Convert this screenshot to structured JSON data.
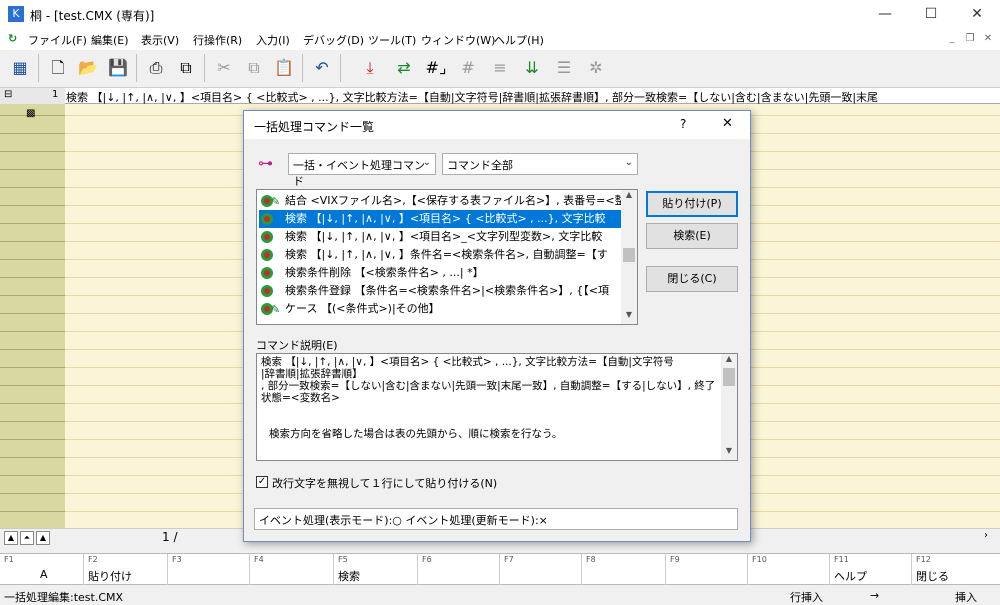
{
  "window": {
    "title": "桐 - [test.CMX (専有)]",
    "minimize": "—",
    "maximize": "☐",
    "close": "✕"
  },
  "menu": [
    "ファイル(F)",
    "編集(E)",
    "表示(V)",
    "行操作(R)",
    "入力(I)",
    "デバッグ(D)",
    "ツール(T)",
    "ウィンドウ(W)",
    "ヘルプ(H)"
  ],
  "formula_bar": {
    "row_number": "1",
    "text": "検索 【|↓, |↑, |∧, |∨, 】<項目名> { <比較式> , ...}, 文字比較方法=【自動|文字符号|辞書順|拡張辞書順】, 部分一致検索=【しない|含む|含まない|先頭一致|末尾"
  },
  "navigation": {
    "page": "1 /"
  },
  "dialog": {
    "title": "一括処理コマンド一覧",
    "help": "?",
    "close": "✕",
    "category_combo": "一括・イベント処理コマンド",
    "filter_combo": "コマンド全部",
    "commands": [
      {
        "text": "結合 <VIXファイル名>,【<保存する表ファイル名>】, 表番号=<整数",
        "pen": true,
        "selected": false
      },
      {
        "text": "検索 【|↓, |↑, |∧, |∨, 】<項目名> { <比較式> , ...}, 文字比較",
        "pen": false,
        "selected": true
      },
      {
        "text": "検索 【|↓, |↑, |∧, |∨, 】<項目名>_<文字列型変数>, 文字比較",
        "pen": false,
        "selected": false
      },
      {
        "text": "検索 【|↓, |↑, |∧, |∨, 】条件名=<検索条件名>, 自動調整=【す",
        "pen": false,
        "selected": false
      },
      {
        "text": "検索条件削除 【<検索条件名> , ...| *】",
        "pen": false,
        "selected": false
      },
      {
        "text": "検索条件登録 【条件名=<検索条件名>|<検索条件名>】, {【<項",
        "pen": false,
        "selected": false
      },
      {
        "text": "ケース 【(<条件式>)|その他】",
        "pen": true,
        "selected": false
      }
    ],
    "buttons": {
      "paste": "貼り付け(P)",
      "search": "検索(E)",
      "close": "閉じる(C)"
    },
    "description_label": "コマンド説明(E)",
    "description_lines": [
      "検索 【|↓, |↑, |∧, |∨, 】<項目名> { <比較式> , ...}, 文字比較方法=【自動|文字符号",
      "|辞書順|拡張辞書順】",
      ", 部分一致検索=【しない|含む|含まない|先頭一致|末尾一致】, 自動調整=【する|しない】, 終了",
      "状態=<変数名>",
      "",
      "",
      "検索方向を省略した場合は表の先頭から、順に検索を行なう。"
    ],
    "checkbox_label": "改行文字を無視して１行にして貼り付ける(N)",
    "checkbox_checked": true,
    "event_status": "イベント処理(表示モード):○ イベント処理(更新モード):×"
  },
  "function_keys": [
    {
      "num": "F1",
      "label": "A"
    },
    {
      "num": "F2",
      "label": "貼り付け"
    },
    {
      "num": "F3",
      "label": ""
    },
    {
      "num": "F4",
      "label": ""
    },
    {
      "num": "F5",
      "label": "検索"
    },
    {
      "num": "F6",
      "label": ""
    },
    {
      "num": "F7",
      "label": ""
    },
    {
      "num": "F8",
      "label": ""
    },
    {
      "num": "F9",
      "label": ""
    },
    {
      "num": "F10",
      "label": ""
    },
    {
      "num": "F11",
      "label": "ヘルプ"
    },
    {
      "num": "F12",
      "label": "閉じる"
    }
  ],
  "status_bar": {
    "mode": "一括処理編集:test.CMX",
    "row_insert": "行挿入",
    "arrow": "→",
    "insert": "挿入"
  }
}
